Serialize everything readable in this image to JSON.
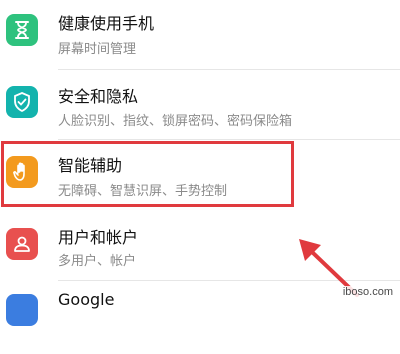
{
  "colors": {
    "health_icon": "#2ec27e",
    "security_icon": "#13b3ad",
    "assist_icon": "#f39a1e",
    "account_icon": "#e8504f",
    "highlight_border": "#e03a3e",
    "arrow": "#e03a3e"
  },
  "settings": {
    "items": [
      {
        "icon": "hourglass-icon",
        "title": "健康使用手机",
        "subtitle": "屏幕时间管理"
      },
      {
        "icon": "shield-check-icon",
        "title": "安全和隐私",
        "subtitle": "人脸识别、指纹、锁屏密码、密码保险箱"
      },
      {
        "icon": "hand-icon",
        "title": "智能辅助",
        "subtitle": "无障碍、智慧识屏、手势控制"
      },
      {
        "icon": "person-icon",
        "title": "用户和帐户",
        "subtitle": "多用户、帐户"
      },
      {
        "icon": "google-icon",
        "title": "Google"
      }
    ]
  },
  "watermark": "iboso.com"
}
